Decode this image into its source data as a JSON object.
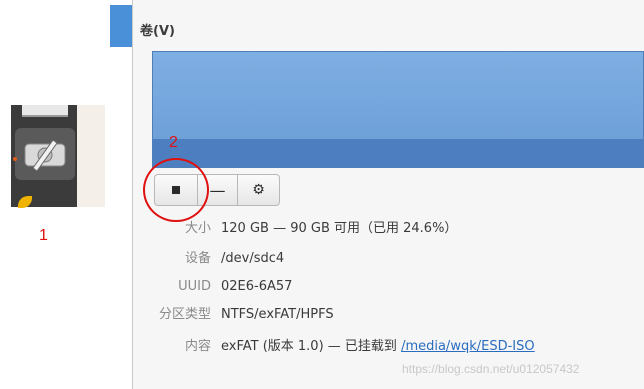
{
  "annotations": {
    "marker1": "1",
    "marker2": "2"
  },
  "launcher": {
    "icon": "disks-app-icon"
  },
  "panel": {
    "section_title": "卷(V)",
    "toolbar": {
      "stop_icon": "stop-square-icon",
      "minus_label": "—",
      "gear_icon": "gear-icon"
    },
    "info": [
      {
        "key": "大小",
        "value": "120 GB — 90 GB 可用（已用 24.6%）"
      },
      {
        "key": "设备",
        "value": "/dev/sdc4"
      },
      {
        "key": "UUID",
        "value": "02E6-6A57"
      },
      {
        "key": "分区类型",
        "value": "NTFS/exFAT/HPFS"
      },
      {
        "key": "内容",
        "value": "exFAT (版本 1.0) — 已挂载到 ",
        "link": "/media/wqk/ESD-ISO"
      }
    ]
  },
  "watermark": "https://blog.csdn.net/u012057432",
  "colors": {
    "accent": "#4a90d9",
    "annotation": "#e01010",
    "volume": "#6a9cd6"
  }
}
